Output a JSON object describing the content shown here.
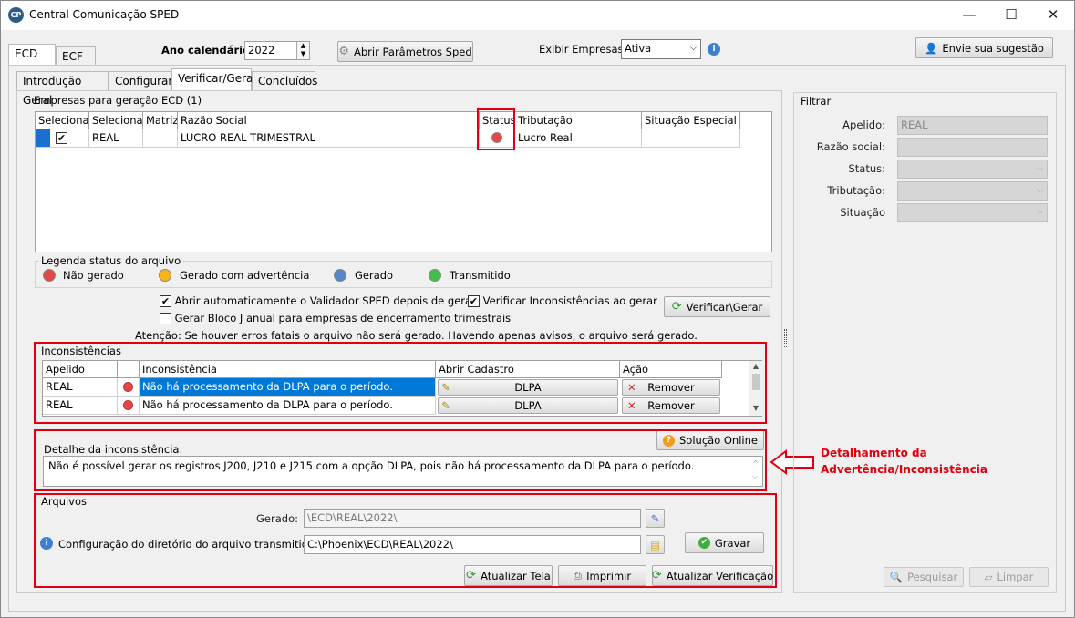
{
  "window": {
    "title": "Central Comunicação SPED",
    "app_icon": "CP",
    "min": "—",
    "max": "☐",
    "close": "✕"
  },
  "top_tabs": [
    "ECD",
    "ECF"
  ],
  "toolbar": {
    "ano_label": "Ano calendário:",
    "ano_value": "2022",
    "abrir_param": "Abrir Parâmetros Sped",
    "exibir_label": "Exibir Empresas:",
    "exibir_value": "Ativa",
    "sugestao": "Envie sua sugestão"
  },
  "sub_tabs": [
    "Introdução Geral",
    "Configurar",
    "Verificar/Gerar",
    "Concluídos"
  ],
  "empresas": {
    "group_title": "Empresas para geração ECD (1)",
    "headers": [
      "Selecionar",
      "Selecionar",
      "Matriz",
      "Razão Social",
      "Status",
      "Tributação",
      "Situação Especial"
    ],
    "rows": [
      {
        "selecionar2": "REAL",
        "matriz": "",
        "razao": "LUCRO REAL TRIMESTRAL",
        "tributacao": "Lucro Real",
        "situacao": ""
      }
    ]
  },
  "legenda": {
    "title": "Legenda status do arquivo",
    "items": [
      {
        "label": "Não gerado",
        "color": "#e34848"
      },
      {
        "label": "Gerado com advertência",
        "color": "#f7b51c"
      },
      {
        "label": "Gerado",
        "color": "#5a85c6"
      },
      {
        "label": "Transmitido",
        "color": "#3fbf4a"
      }
    ]
  },
  "options": {
    "abrir_validador": "Abrir automaticamente o Validador SPED depois de gerar.",
    "verificar_inc": "Verificar Inconsistências ao gerar",
    "gerar_bloco": "Gerar Bloco J anual para empresas de encerramento trimestrais",
    "verificar_btn": "Verificar\\Gerar",
    "atencao": "Atenção: Se houver erros fatais o arquivo não será gerado. Havendo apenas avisos, o arquivo será gerado."
  },
  "inconsistencias": {
    "title": "Inconsistências",
    "headers": [
      "Apelido",
      "",
      "Inconsistência",
      "Abrir Cadastro",
      "Ação"
    ],
    "rows": [
      {
        "apelido": "REAL",
        "texto": "Não há processamento da DLPA para o período.",
        "cadastro": "DLPA",
        "acao": "Remover"
      },
      {
        "apelido": "REAL",
        "texto": "Não há processamento da DLPA para o período.",
        "cadastro": "DLPA",
        "acao": "Remover"
      }
    ]
  },
  "detalhe": {
    "solucao_btn": "Solução Online",
    "label": "Detalhe da inconsistência:",
    "text": "Não é possível gerar os registros J200, J210 e J215 com a opção DLPA, pois não há processamento da DLPA para o período."
  },
  "annotation": {
    "line1": "Detalhamento da",
    "line2": "Advertência/Inconsistência"
  },
  "arquivos": {
    "title": "Arquivos",
    "gerado_label": "Gerado:",
    "gerado_value": "\\ECD\\REAL\\2022\\",
    "config_label": "Configuração do diretório do arquivo transmitido:",
    "config_value": "C:\\Phoenix\\ECD\\REAL\\2022\\",
    "gravar": "Gravar",
    "atualizar_tela": "Atualizar Tela",
    "imprimir": "Imprimir",
    "atualizar_verif": "Atualizar Verificação"
  },
  "filtrar": {
    "title": "Filtrar",
    "apelido_label": "Apelido:",
    "apelido_value": "REAL",
    "razao_label": "Razão social:",
    "status_label": "Status:",
    "tributacao_label": "Tributação:",
    "situacao_label": "Situação",
    "pesquisar": "Pesquisar",
    "limpar": "Limpar"
  }
}
